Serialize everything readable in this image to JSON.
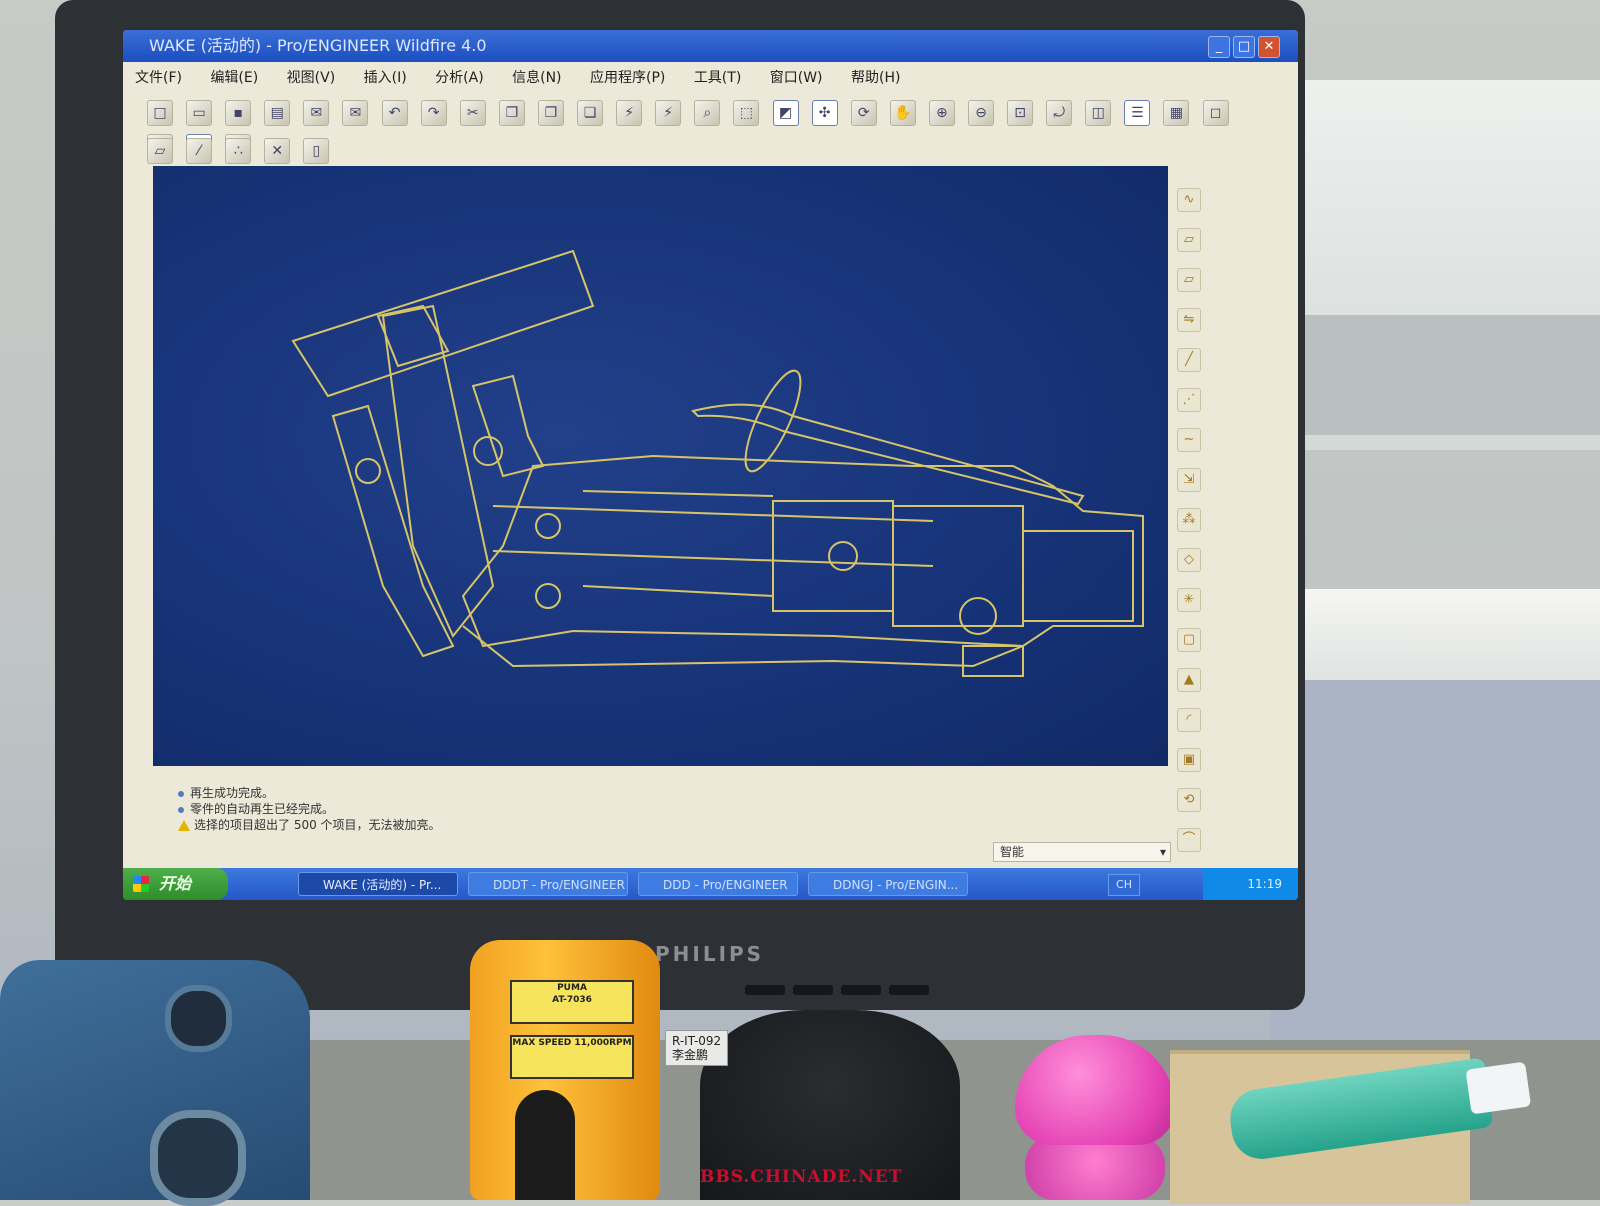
{
  "window": {
    "title": "WAKE (活动的) - Pro/ENGINEER Wildfire 4.0",
    "controls": [
      "minimize",
      "maximize",
      "close"
    ]
  },
  "menu": [
    "文件(F)",
    "编辑(E)",
    "视图(V)",
    "插入(I)",
    "分析(A)",
    "信息(N)",
    "应用程序(P)",
    "工具(T)",
    "窗口(W)",
    "帮助(H)"
  ],
  "toolbar_icons": [
    "new-icon",
    "open-icon",
    "save-icon",
    "print-icon",
    "send-icon",
    "mail-icon",
    "undo-icon",
    "redo-icon",
    "cut-icon",
    "copy-icon",
    "paste-icon",
    "paste-special-icon",
    "regenerate-icon",
    "regen-manager-icon",
    "find-icon",
    "select-box-icon",
    "repaint-icon",
    "spin-center-icon",
    "orient-icon",
    "pan-icon",
    "zoom-in-icon",
    "zoom-out-icon",
    "refit-icon",
    "reorient-icon",
    "saved-views-icon",
    "layers-icon",
    "model-tree-icon",
    "wireframe-icon",
    "hidden-line-icon",
    "no-hidden-icon",
    "shaded-icon"
  ],
  "messages": [
    {
      "type": "info",
      "text": "再生成功完成。"
    },
    {
      "type": "info",
      "text": "零件的自动再生已经完成。"
    },
    {
      "type": "warning",
      "text": "选择的项目超出了 500 个项目，无法被加亮。"
    }
  ],
  "filter": {
    "value": "智能"
  },
  "taskbar": {
    "start_label": "开始",
    "tasks": [
      {
        "label": "WAKE (活动的) - Pr...",
        "active": true
      },
      {
        "label": "DDDT - Pro/ENGINEER",
        "active": false
      },
      {
        "label": "DDD - Pro/ENGINEER",
        "active": false
      },
      {
        "label": "DDNGJ - Pro/ENGIN...",
        "active": false
      }
    ],
    "lang": "CH",
    "clock": "11:19"
  },
  "monitor": {
    "brand": "PHILIPS",
    "asset_tag_line1": "R-IT-092",
    "asset_tag_line2": "李金鹏"
  },
  "grinder": {
    "brand": "PUMA",
    "model": "AT-7036",
    "speed": "MAX SPEED 11,000RPM"
  },
  "watermark": "BBS.CHINADE.NET",
  "colors": {
    "viewport": "#173479",
    "wireframe": "#d7c468",
    "taskbar": "#2557c6"
  }
}
